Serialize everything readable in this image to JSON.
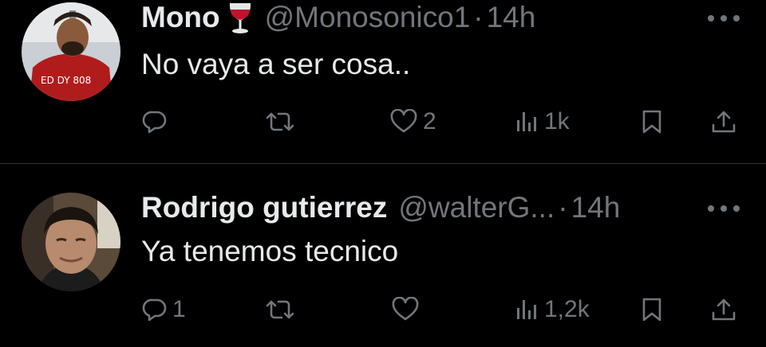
{
  "tweets": [
    {
      "name": "Mono",
      "emoji_icon": "wine-glass-icon",
      "handle": "@Monosonico1",
      "separator": "·",
      "time": "14h",
      "text": "No vaya a ser cosa..",
      "replies": "",
      "retweets": "",
      "likes": "2",
      "views": "1k",
      "avatar_colors": {
        "shirt": "#b01c1c",
        "bg": "#c9cfd4"
      }
    },
    {
      "name": "Rodrigo gutierrez",
      "handle": "@walterG...",
      "separator": "·",
      "time": "14h",
      "text": "Ya tenemos tecnico",
      "replies": "1",
      "retweets": "",
      "likes": "",
      "views": "1,2k",
      "avatar_colors": {
        "skin": "#b88a6e",
        "bg": "#5a4a3a"
      }
    }
  ],
  "colors": {
    "background": "#000000",
    "text": "#e7e9ea",
    "muted": "#71767b",
    "divider": "#2f3336"
  },
  "icons": [
    "reply-icon",
    "retweet-icon",
    "like-icon",
    "views-icon",
    "bookmark-icon",
    "share-icon",
    "more-icon"
  ]
}
